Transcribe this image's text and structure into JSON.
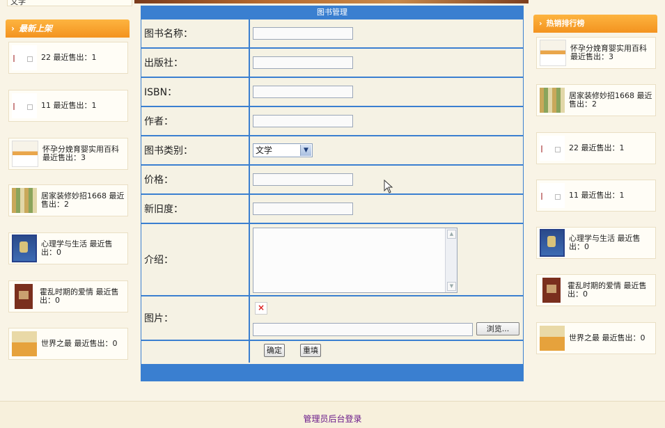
{
  "left_top_text": "文学",
  "left_sidebar": {
    "title": "最新上架",
    "items": [
      {
        "thumb": "blank",
        "text": "22 最近售出：1"
      },
      {
        "thumb": "blank",
        "text": "11 最近售出：1"
      },
      {
        "thumb": "book1",
        "text": "怀孕分娩育婴实用百科 最近售出：3"
      },
      {
        "thumb": "book2",
        "text": "居家装修妙招1668 最近售出：2"
      },
      {
        "thumb": "book3",
        "text": "心理学与生活 最近售出：0"
      },
      {
        "thumb": "book4",
        "text": "霍乱时期的爱情 最近售出：0"
      },
      {
        "thumb": "book5",
        "text": "世界之最 最近售出：0"
      }
    ]
  },
  "right_sidebar": {
    "title": "热销排行榜",
    "items": [
      {
        "thumb": "book1",
        "text": "怀孕分娩育婴实用百科 最近售出：3"
      },
      {
        "thumb": "book2",
        "text": "居家装修妙招1668 最近售出：2"
      },
      {
        "thumb": "blank",
        "text": "22 最近售出：1"
      },
      {
        "thumb": "blank",
        "text": "11 最近售出：1"
      },
      {
        "thumb": "book3",
        "text": "心理学与生活 最近售出：0"
      },
      {
        "thumb": "book4",
        "text": "霍乱时期的爱情 最近售出：0"
      },
      {
        "thumb": "book5",
        "text": "世界之最 最近售出：0"
      }
    ]
  },
  "form": {
    "title": "图书管理",
    "labels": {
      "name": "图书名称：",
      "publisher": "出版社：",
      "isbn": "ISBN：",
      "author": "作者：",
      "category": "图书类别：",
      "price": "价格：",
      "condition": "新旧度：",
      "intro": "介绍：",
      "image": "图片："
    },
    "values": {
      "name": "",
      "publisher": "",
      "isbn": "",
      "author": "",
      "category": "文学",
      "price": "",
      "condition": "",
      "intro": "",
      "image_path": ""
    },
    "browse_label": "浏览...",
    "submit_label": "确定",
    "reset_label": "重填"
  },
  "footer": {
    "admin_link": "管理员后台登录"
  },
  "colors": {
    "accent_blue": "#3a7fd0",
    "header_orange": "#f3931f",
    "background": "#f9f4e6",
    "footer_link": "#6a1a8a"
  },
  "icons": {
    "sidebar_arrow": "chevron-right-icon",
    "broken_image": "broken-image-icon",
    "select_arrow": "chevron-down-icon",
    "cursor": "mouse-cursor-icon"
  }
}
